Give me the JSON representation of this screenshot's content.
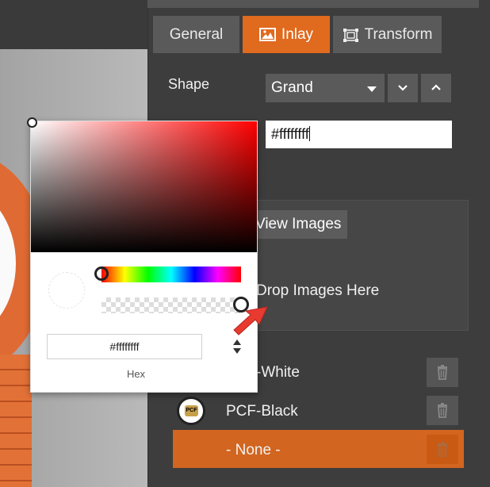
{
  "tabs": [
    {
      "label": "General",
      "icon": "none",
      "active": false
    },
    {
      "label": "Inlay",
      "icon": "image-icon",
      "active": true
    },
    {
      "label": "Transform",
      "icon": "transform-icon",
      "active": false
    }
  ],
  "shape": {
    "label": "Shape",
    "selected": "Grand"
  },
  "color_field": {
    "value": "#ffffffff"
  },
  "images": {
    "view_button": "View Images",
    "drop_text": "Drop Images Here"
  },
  "inlay_list": [
    {
      "label": "PCF-White",
      "selected": false
    },
    {
      "label": "PCF-Black",
      "selected": false
    },
    {
      "label": "- None -",
      "selected": true
    }
  ],
  "picker": {
    "hex_value": "#ffffffff",
    "mode_label": "Hex",
    "alpha": 1
  },
  "colors": {
    "accent": "#e06a1e",
    "panel": "#3d3d3d",
    "tab_inactive": "#5a5a5a",
    "arrow": "#e83a2f"
  }
}
